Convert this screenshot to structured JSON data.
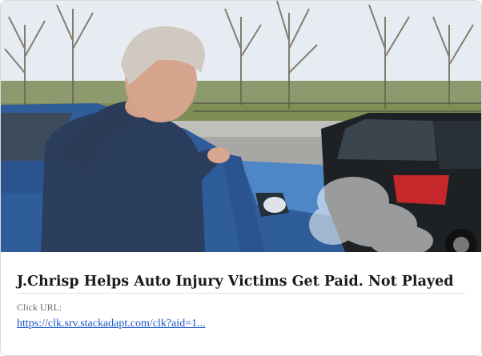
{
  "card": {
    "image_alt": "Man holding his neck after a car collision",
    "headline": "J.Chrisp Helps Auto Injury Victims Get Paid. Not Played",
    "click_label": "Click URL:",
    "click_url": "https://clk.srv.stackadapt.com/clk?aid=1..."
  },
  "colors": {
    "headline": "#1a1a1a",
    "label": "#6b6b6b",
    "link": "#1a56c8"
  }
}
